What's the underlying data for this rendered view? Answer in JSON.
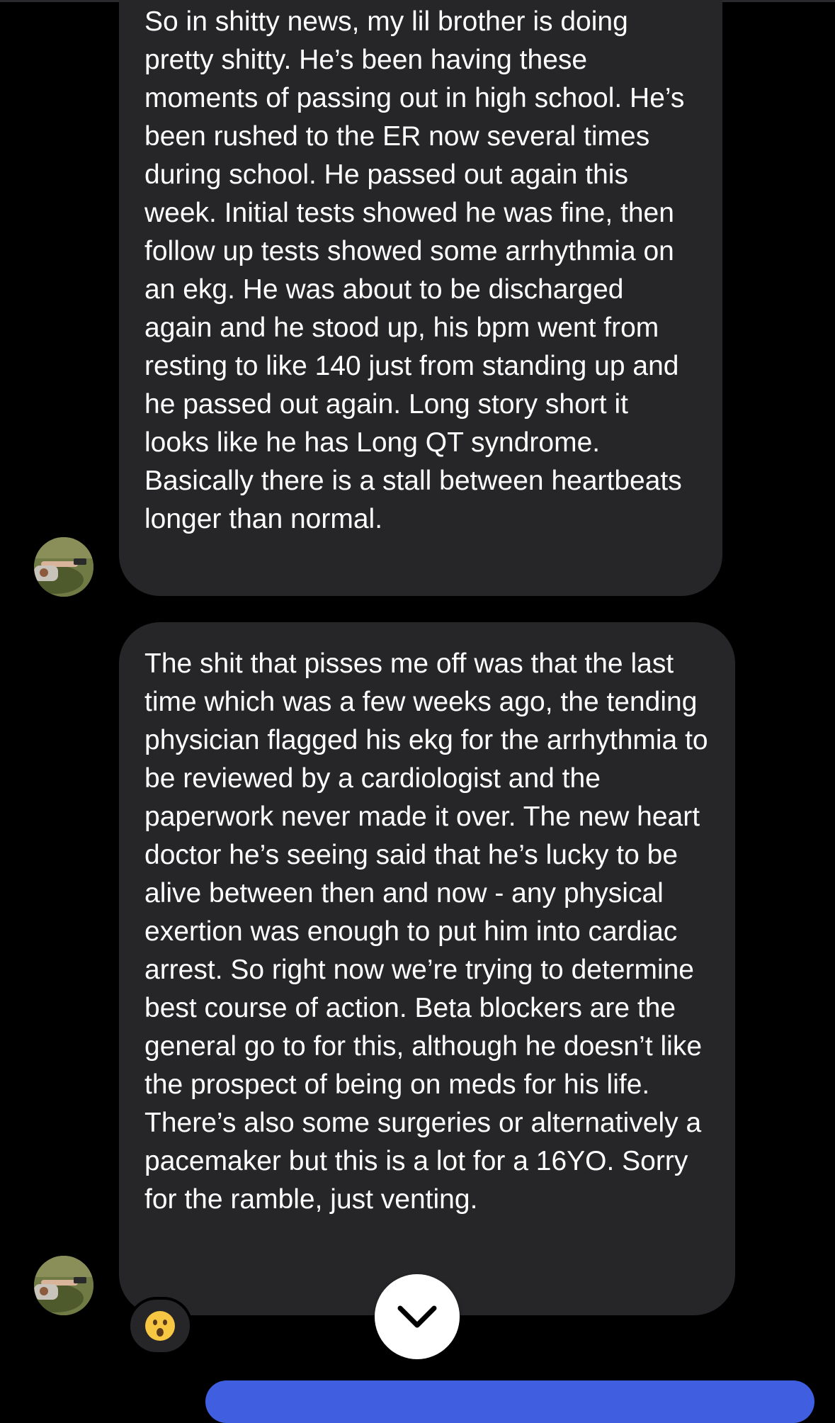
{
  "messages": [
    {
      "sender": "other",
      "text": "So in shitty news, my lil brother is doing pretty shitty. He’s been having these moments of passing out in high school. He’s been rushed to the ER now several times during school. He passed out again this week. Initial tests showed he was fine, then follow up tests showed some arrhythmia on an ekg. He was about to be discharged again and he stood up, his bpm went from resting to like 140 just from standing up and he passed out again. Long story short it looks like he has Long QT syndrome. Basically there is a stall between heartbeats longer than normal."
    },
    {
      "sender": "other",
      "text": "The shit that pisses me off was that the last time which was a few weeks ago, the tending physician flagged his ekg for the arrhythmia to be reviewed by a cardiologist and the paperwork never made it over. The new heart doctor he’s seeing said that he’s lucky to be alive between then and now - any physical exertion was enough to put him into cardiac arrest. So right now we’re trying to determine best course of action. Beta blockers are the general go to for this, although he doesn’t like the prospect of being on meds for his life. There’s also some surgeries or alternatively a pacemaker but this is a lot for a 16YO. Sorry for the ramble, just venting.",
      "reaction": "astonished-face-emoji"
    }
  ],
  "icons": {
    "avatar": "user-avatar",
    "reaction": "astonished-face-emoji",
    "scroll": "chevron-down-icon"
  },
  "colors": {
    "background": "#000000",
    "bubble": "#262628",
    "text": "#ffffff",
    "scroll_button": "#ffffff",
    "outgoing_bubble": "#3f5fe0"
  }
}
